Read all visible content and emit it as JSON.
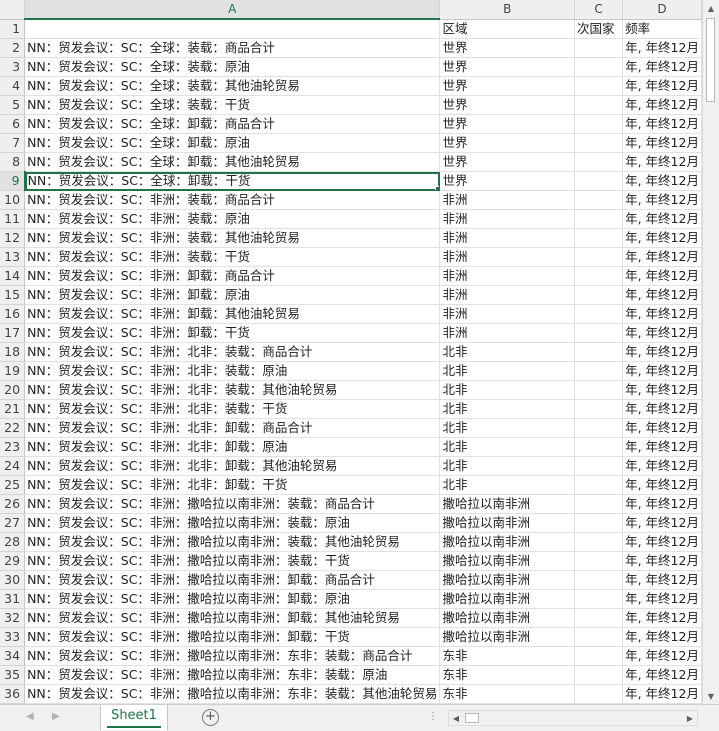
{
  "columns": {
    "corner": "",
    "a": "A",
    "b": "B",
    "c": "C",
    "d": "D"
  },
  "header_row": {
    "num": "1",
    "a": "",
    "b": "区域",
    "c": "次国家",
    "d": "频率"
  },
  "rows": [
    {
      "num": "2",
      "a": "NN：贸发会议：SC：全球：装载：商品合计",
      "b": "世界",
      "c": "",
      "d": "年, 年终12月"
    },
    {
      "num": "3",
      "a": "NN：贸发会议：SC：全球：装载：原油",
      "b": "世界",
      "c": "",
      "d": "年, 年终12月"
    },
    {
      "num": "4",
      "a": "NN：贸发会议：SC：全球：装载：其他油轮贸易",
      "b": "世界",
      "c": "",
      "d": "年, 年终12月"
    },
    {
      "num": "5",
      "a": "NN：贸发会议：SC：全球：装载：干货",
      "b": "世界",
      "c": "",
      "d": "年, 年终12月"
    },
    {
      "num": "6",
      "a": "NN：贸发会议：SC：全球：卸载：商品合计",
      "b": "世界",
      "c": "",
      "d": "年, 年终12月"
    },
    {
      "num": "7",
      "a": "NN：贸发会议：SC：全球：卸载：原油",
      "b": "世界",
      "c": "",
      "d": "年, 年终12月"
    },
    {
      "num": "8",
      "a": "NN：贸发会议：SC：全球：卸载：其他油轮贸易",
      "b": "世界",
      "c": "",
      "d": "年, 年终12月"
    },
    {
      "num": "9",
      "a": "NN：贸发会议：SC：全球：卸载：干货",
      "b": "世界",
      "c": "",
      "d": "年, 年终12月"
    },
    {
      "num": "10",
      "a": "NN：贸发会议：SC：非洲：装载：商品合计",
      "b": "非洲",
      "c": "",
      "d": "年, 年终12月"
    },
    {
      "num": "11",
      "a": "NN：贸发会议：SC：非洲：装载：原油",
      "b": "非洲",
      "c": "",
      "d": "年, 年终12月"
    },
    {
      "num": "12",
      "a": "NN：贸发会议：SC：非洲：装载：其他油轮贸易",
      "b": "非洲",
      "c": "",
      "d": "年, 年终12月"
    },
    {
      "num": "13",
      "a": "NN：贸发会议：SC：非洲：装载：干货",
      "b": "非洲",
      "c": "",
      "d": "年, 年终12月"
    },
    {
      "num": "14",
      "a": "NN：贸发会议：SC：非洲：卸载：商品合计",
      "b": "非洲",
      "c": "",
      "d": "年, 年终12月"
    },
    {
      "num": "15",
      "a": "NN：贸发会议：SC：非洲：卸载：原油",
      "b": "非洲",
      "c": "",
      "d": "年, 年终12月"
    },
    {
      "num": "16",
      "a": "NN：贸发会议：SC：非洲：卸载：其他油轮贸易",
      "b": "非洲",
      "c": "",
      "d": "年, 年终12月"
    },
    {
      "num": "17",
      "a": "NN：贸发会议：SC：非洲：卸载：干货",
      "b": "非洲",
      "c": "",
      "d": "年, 年终12月"
    },
    {
      "num": "18",
      "a": "NN：贸发会议：SC：非洲：北非：装载：商品合计",
      "b": "北非",
      "c": "",
      "d": "年, 年终12月"
    },
    {
      "num": "19",
      "a": "NN：贸发会议：SC：非洲：北非：装载：原油",
      "b": "北非",
      "c": "",
      "d": "年, 年终12月"
    },
    {
      "num": "20",
      "a": "NN：贸发会议：SC：非洲：北非：装载：其他油轮贸易",
      "b": "北非",
      "c": "",
      "d": "年, 年终12月"
    },
    {
      "num": "21",
      "a": "NN：贸发会议：SC：非洲：北非：装载：干货",
      "b": "北非",
      "c": "",
      "d": "年, 年终12月"
    },
    {
      "num": "22",
      "a": "NN：贸发会议：SC：非洲：北非：卸载：商品合计",
      "b": "北非",
      "c": "",
      "d": "年, 年终12月"
    },
    {
      "num": "23",
      "a": "NN：贸发会议：SC：非洲：北非：卸载：原油",
      "b": "北非",
      "c": "",
      "d": "年, 年终12月"
    },
    {
      "num": "24",
      "a": "NN：贸发会议：SC：非洲：北非：卸载：其他油轮贸易",
      "b": "北非",
      "c": "",
      "d": "年, 年终12月"
    },
    {
      "num": "25",
      "a": "NN：贸发会议：SC：非洲：北非：卸载：干货",
      "b": "北非",
      "c": "",
      "d": "年, 年终12月"
    },
    {
      "num": "26",
      "a": "NN：贸发会议：SC：非洲：撒哈拉以南非洲：装载：商品合计",
      "b": "撒哈拉以南非洲",
      "c": "",
      "d": "年, 年终12月"
    },
    {
      "num": "27",
      "a": "NN：贸发会议：SC：非洲：撒哈拉以南非洲：装载：原油",
      "b": "撒哈拉以南非洲",
      "c": "",
      "d": "年, 年终12月"
    },
    {
      "num": "28",
      "a": "NN：贸发会议：SC：非洲：撒哈拉以南非洲：装载：其他油轮贸易",
      "b": "撒哈拉以南非洲",
      "c": "",
      "d": "年, 年终12月"
    },
    {
      "num": "29",
      "a": "NN：贸发会议：SC：非洲：撒哈拉以南非洲：装载：干货",
      "b": "撒哈拉以南非洲",
      "c": "",
      "d": "年, 年终12月"
    },
    {
      "num": "30",
      "a": "NN：贸发会议：SC：非洲：撒哈拉以南非洲：卸载：商品合计",
      "b": "撒哈拉以南非洲",
      "c": "",
      "d": "年, 年终12月"
    },
    {
      "num": "31",
      "a": "NN：贸发会议：SC：非洲：撒哈拉以南非洲：卸载：原油",
      "b": "撒哈拉以南非洲",
      "c": "",
      "d": "年, 年终12月"
    },
    {
      "num": "32",
      "a": "NN：贸发会议：SC：非洲：撒哈拉以南非洲：卸载：其他油轮贸易",
      "b": "撒哈拉以南非洲",
      "c": "",
      "d": "年, 年终12月"
    },
    {
      "num": "33",
      "a": "NN：贸发会议：SC：非洲：撒哈拉以南非洲：卸载：干货",
      "b": "撒哈拉以南非洲",
      "c": "",
      "d": "年, 年终12月"
    },
    {
      "num": "34",
      "a": "NN：贸发会议：SC：非洲：撒哈拉以南非洲：东非：装载：商品合计",
      "b": "东非",
      "c": "",
      "d": "年, 年终12月"
    },
    {
      "num": "35",
      "a": "NN：贸发会议：SC：非洲：撒哈拉以南非洲：东非：装载：原油",
      "b": "东非",
      "c": "",
      "d": "年, 年终12月"
    },
    {
      "num": "36",
      "a": "NN：贸发会议：SC：非洲：撒哈拉以南非洲：东非：装载：其他油轮贸易",
      "b": "东非",
      "c": "",
      "d": "年, 年终12月"
    }
  ],
  "selected_row": "9",
  "sheet_tab": "Sheet1",
  "icons": {
    "add_sheet": "plus-circle-icon",
    "scroll_up": "arrow-up-icon",
    "scroll_down": "arrow-down-icon"
  },
  "colors": {
    "accent": "#217346"
  }
}
